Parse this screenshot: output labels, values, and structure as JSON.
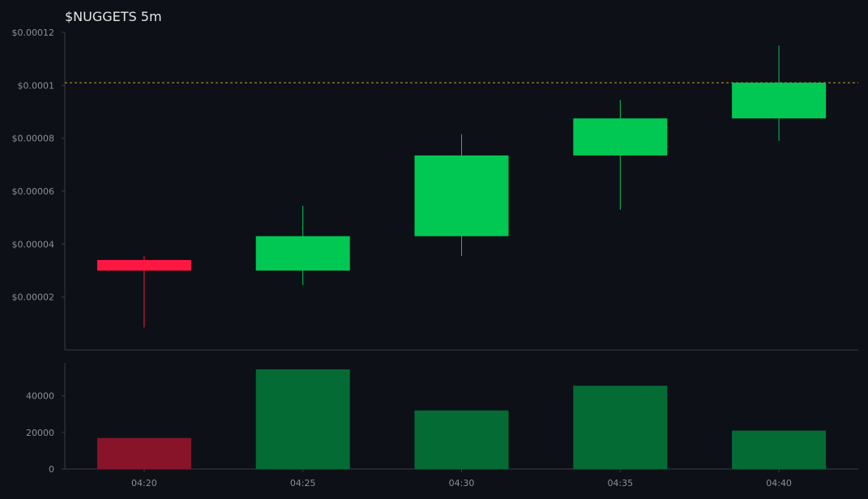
{
  "chart_data": {
    "type": "candlestick",
    "title": "$NUGGETS 5m",
    "x": [
      "04:20",
      "04:25",
      "04:30",
      "04:35",
      "04:40"
    ],
    "ohlc": [
      {
        "open": 3.4e-05,
        "high": 3.55e-05,
        "low": 8.5e-06,
        "close": 3e-05
      },
      {
        "open": 3e-05,
        "high": 5.45e-05,
        "low": 2.45e-05,
        "close": 4.3e-05
      },
      {
        "open": 4.3e-05,
        "high": 8.15e-05,
        "low": 3.55e-05,
        "close": 7.35e-05
      },
      {
        "open": 7.35e-05,
        "high": 9.45e-05,
        "low": 5.3e-05,
        "close": 8.75e-05
      },
      {
        "open": 8.75e-05,
        "high": 0.000115,
        "low": 7.9e-05,
        "close": 0.000101
      }
    ],
    "price_ylim": [
      0,
      0.00012
    ],
    "price_ticks": [
      2e-05,
      4e-05,
      6e-05,
      8e-05,
      0.0001,
      0.00012
    ],
    "price_tick_labels": [
      "$0.00002",
      "$0.00004",
      "$0.00006",
      "$0.00008",
      "$0.0001",
      "$0.00012"
    ],
    "reference_line": 0.000101,
    "volume": [
      17000,
      54500,
      32000,
      45500,
      21000
    ],
    "volume_ylim": [
      0,
      58000
    ],
    "volume_ticks": [
      0,
      20000,
      40000
    ],
    "volume_tick_labels": [
      "0",
      "20000",
      "40000"
    ],
    "colors": {
      "up": "#00c853",
      "down": "#ff1744",
      "volume_up": "#056b34",
      "volume_down": "#871428",
      "reference_line": "#c9a227",
      "background": "#0d1017",
      "axis": "#3a3d44",
      "tick_text": "#8a8f98",
      "title": "#e6e6e6"
    }
  }
}
